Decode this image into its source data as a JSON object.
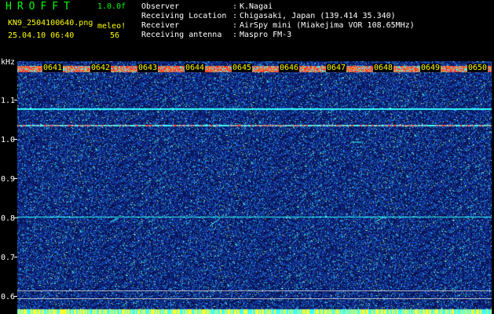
{
  "header": {
    "brand": "HROFFT",
    "version": "1.0.0f",
    "filename": "KN9_2504100640.png",
    "datetime": "25.04.10 06:40",
    "meleo_label": "meleo!",
    "count": "56",
    "info": [
      {
        "label": "Observer",
        "value": "K.Nagai"
      },
      {
        "label": "Receiving Location",
        "value": "Chigasaki, Japan (139.414 35.340)"
      },
      {
        "label": "Receiver",
        "value": "AirSpy mini (Miakejima VOR 108.65MHz)"
      },
      {
        "label": "Receiving antenna",
        "value": "Maspro FM-3"
      }
    ],
    "sep": ":"
  },
  "axis": {
    "unit": "kHz",
    "ticks": [
      "1.1",
      "1.0",
      "0.9",
      "0.8",
      "0.7",
      "0.6"
    ]
  },
  "time_labels": [
    "0641",
    "0642",
    "0643",
    "0644",
    "0645",
    "0646",
    "0647",
    "0648",
    "0649",
    "0650"
  ],
  "colors": {
    "background_noise": "#1a2aa0",
    "signal_cyan": "#33ffff",
    "hot_band": "#ff3030",
    "text_yellow": "#ffff00",
    "text_green": "#00ff00"
  }
}
